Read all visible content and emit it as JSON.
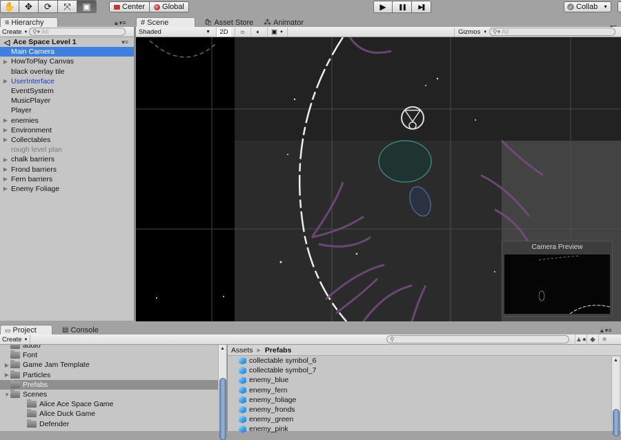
{
  "toolbar": {
    "tools": [
      {
        "name": "hand-tool",
        "icon": "✋"
      },
      {
        "name": "move-tool",
        "icon": "✥"
      },
      {
        "name": "rotate-tool",
        "icon": "⟳"
      },
      {
        "name": "scale-tool",
        "icon": "⤧"
      },
      {
        "name": "rect-tool",
        "icon": "▣"
      }
    ],
    "pivot_label": "Center",
    "space_label": "Global",
    "play_icon": "▶",
    "pause_icon": "❚❚",
    "step_icon": "▶❚",
    "collab_label": "Collab"
  },
  "hierarchy": {
    "tab_label": "Hierarchy",
    "create_label": "Create",
    "search_placeholder": "All",
    "scene_name": "Ace Space Level  1",
    "items": [
      {
        "label": "Main Camera",
        "expandable": false,
        "state": "selected"
      },
      {
        "label": "HowToPlay Canvas",
        "expandable": true,
        "state": "normal"
      },
      {
        "label": "black overlay tile",
        "expandable": false,
        "state": "normal"
      },
      {
        "label": "UserInterface",
        "expandable": true,
        "state": "prefab"
      },
      {
        "label": "EventSystem",
        "expandable": false,
        "state": "normal"
      },
      {
        "label": "MusicPlayer",
        "expandable": false,
        "state": "normal"
      },
      {
        "label": "Player",
        "expandable": false,
        "state": "normal"
      },
      {
        "label": "enemies",
        "expandable": true,
        "state": "normal"
      },
      {
        "label": "Environment",
        "expandable": true,
        "state": "normal"
      },
      {
        "label": "Collectables",
        "expandable": true,
        "state": "normal"
      },
      {
        "label": "rough level plan",
        "expandable": false,
        "state": "inactive"
      },
      {
        "label": "chalk barriers",
        "expandable": true,
        "state": "normal"
      },
      {
        "label": "Frond barriers",
        "expandable": true,
        "state": "normal"
      },
      {
        "label": "Fern barriers",
        "expandable": true,
        "state": "normal"
      },
      {
        "label": "Enemy Foliage",
        "expandable": true,
        "state": "normal"
      }
    ]
  },
  "scene": {
    "tabs": [
      {
        "label": "Scene",
        "icon": "#"
      },
      {
        "label": "Asset Store",
        "icon": "🛍"
      },
      {
        "label": "Animator",
        "icon": "⁂"
      }
    ],
    "shading_mode": "Shaded",
    "mode_2d_label": "2D",
    "lighting_icon": "☼",
    "audio_icon": "🔈",
    "effects_icon": "▣",
    "gizmos_label": "Gizmos",
    "search_placeholder": "All",
    "camera_preview_title": "Camera Preview"
  },
  "project": {
    "tab_label": "Project",
    "console_tab_label": "Console",
    "create_label": "Create",
    "folders": [
      {
        "label": "audio",
        "indent": 1,
        "expandable": false,
        "selected": false
      },
      {
        "label": "Font",
        "indent": 1,
        "expandable": false,
        "selected": false
      },
      {
        "label": "Game Jam Template",
        "indent": 1,
        "expandable": true,
        "selected": false
      },
      {
        "label": "Particles",
        "indent": 1,
        "expandable": true,
        "selected": false
      },
      {
        "label": "Prefabs",
        "indent": 1,
        "expandable": false,
        "selected": true
      },
      {
        "label": "Scenes",
        "indent": 1,
        "expandable": true,
        "expanded": true,
        "selected": false
      },
      {
        "label": "Alice Ace Space Game",
        "indent": 2,
        "expandable": false,
        "selected": false
      },
      {
        "label": "Alice Duck Game",
        "indent": 2,
        "expandable": false,
        "selected": false
      },
      {
        "label": "Defender",
        "indent": 2,
        "expandable": false,
        "selected": false
      }
    ],
    "breadcrumb": [
      "Assets",
      "Prefabs"
    ],
    "assets": [
      "collectable symbol_6",
      "collectable symbol_7",
      "enemy_blue",
      "enemy_fern",
      "enemy_foliage",
      "enemy_fronds",
      "enemy_green",
      "enemy_pink"
    ]
  }
}
